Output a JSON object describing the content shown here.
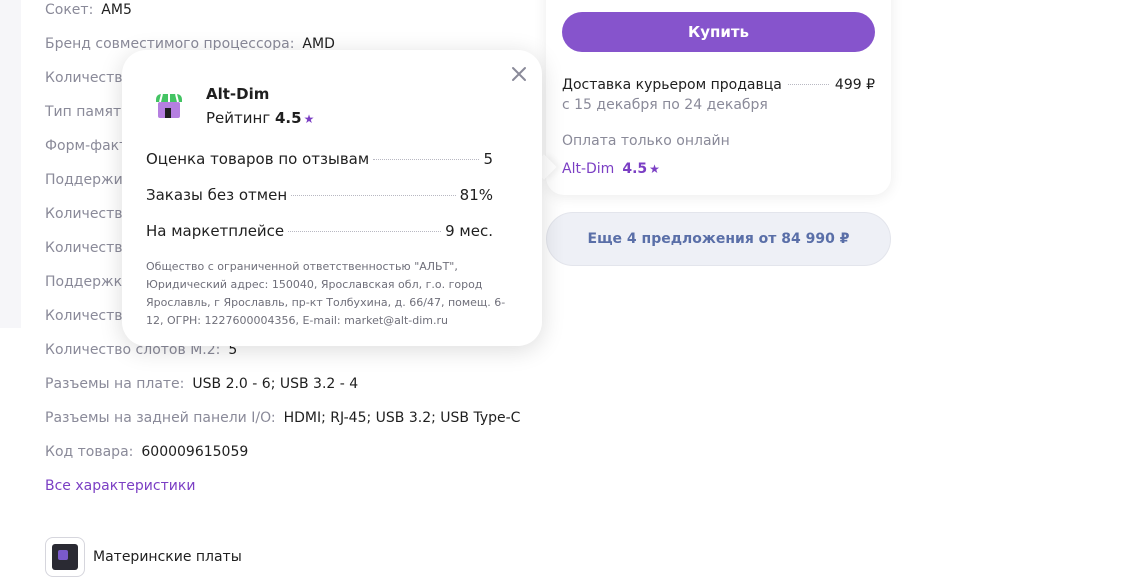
{
  "specs": [
    {
      "label": "Сокет:",
      "value": "AM5"
    },
    {
      "label": "Бренд совместимого процессора:",
      "value": "AMD"
    },
    {
      "label": "Количество",
      "value": ""
    },
    {
      "label": "Тип памяти",
      "value": ""
    },
    {
      "label": "Форм-факт",
      "value": ""
    },
    {
      "label": "Поддержив",
      "value": ""
    },
    {
      "label": "Количество",
      "value": ""
    },
    {
      "label": "Количество",
      "value": ""
    },
    {
      "label": "Поддержка",
      "value": ""
    },
    {
      "label": "Количество",
      "value": ""
    },
    {
      "label": "Количество слотов M.2:",
      "value": "5"
    },
    {
      "label": "Разъемы на плате:",
      "value": "USB 2.0 - 6; USB 3.2 - 4"
    },
    {
      "label": "Разъемы на задней панели I/O:",
      "value": "HDMI; RJ-45; USB 3.2; USB Type-C"
    },
    {
      "label": "Код товара:",
      "value": "600009615059"
    }
  ],
  "all_specs_link": "Все характеристики",
  "category": {
    "label": "Материнские платы"
  },
  "buy_card": {
    "buy_label": "Купить",
    "delivery_label": "Доставка курьером продавца",
    "delivery_price": "499 ₽",
    "delivery_dates": "с 15 декабря по 24 декабря",
    "payment_note": "Оплата только онлайн",
    "seller_name": "Alt-Dim",
    "seller_rating": "4.5"
  },
  "more_offers": "Еще 4 предложения от 84 990 ₽",
  "popup": {
    "shop_name": "Alt-Dim",
    "rating_label": "Рейтинг",
    "rating_value": "4.5",
    "stats": [
      {
        "label": "Оценка товаров по отзывам",
        "value": "5"
      },
      {
        "label": "Заказы без отмен",
        "value": "81%"
      },
      {
        "label": "На маркетплейсе",
        "value": "9 мес."
      }
    ],
    "legal_text": "Общество с ограниченной ответственностью \"АЛЬТ\", Юридический адрес: 150040, Ярославская обл, г.о. город Ярославль, г Ярославль, пр-кт Толбухина, д. 66/47, помещ. 6-12, ОГРН: 1227600004356, E-mail: market@alt-dim.ru"
  },
  "icons": {
    "close": "close-icon",
    "star": "star-icon",
    "shop": "shop-icon"
  },
  "colors": {
    "accent": "#8654cc",
    "link": "#7b3fc4",
    "muted": "#8a8a99"
  }
}
